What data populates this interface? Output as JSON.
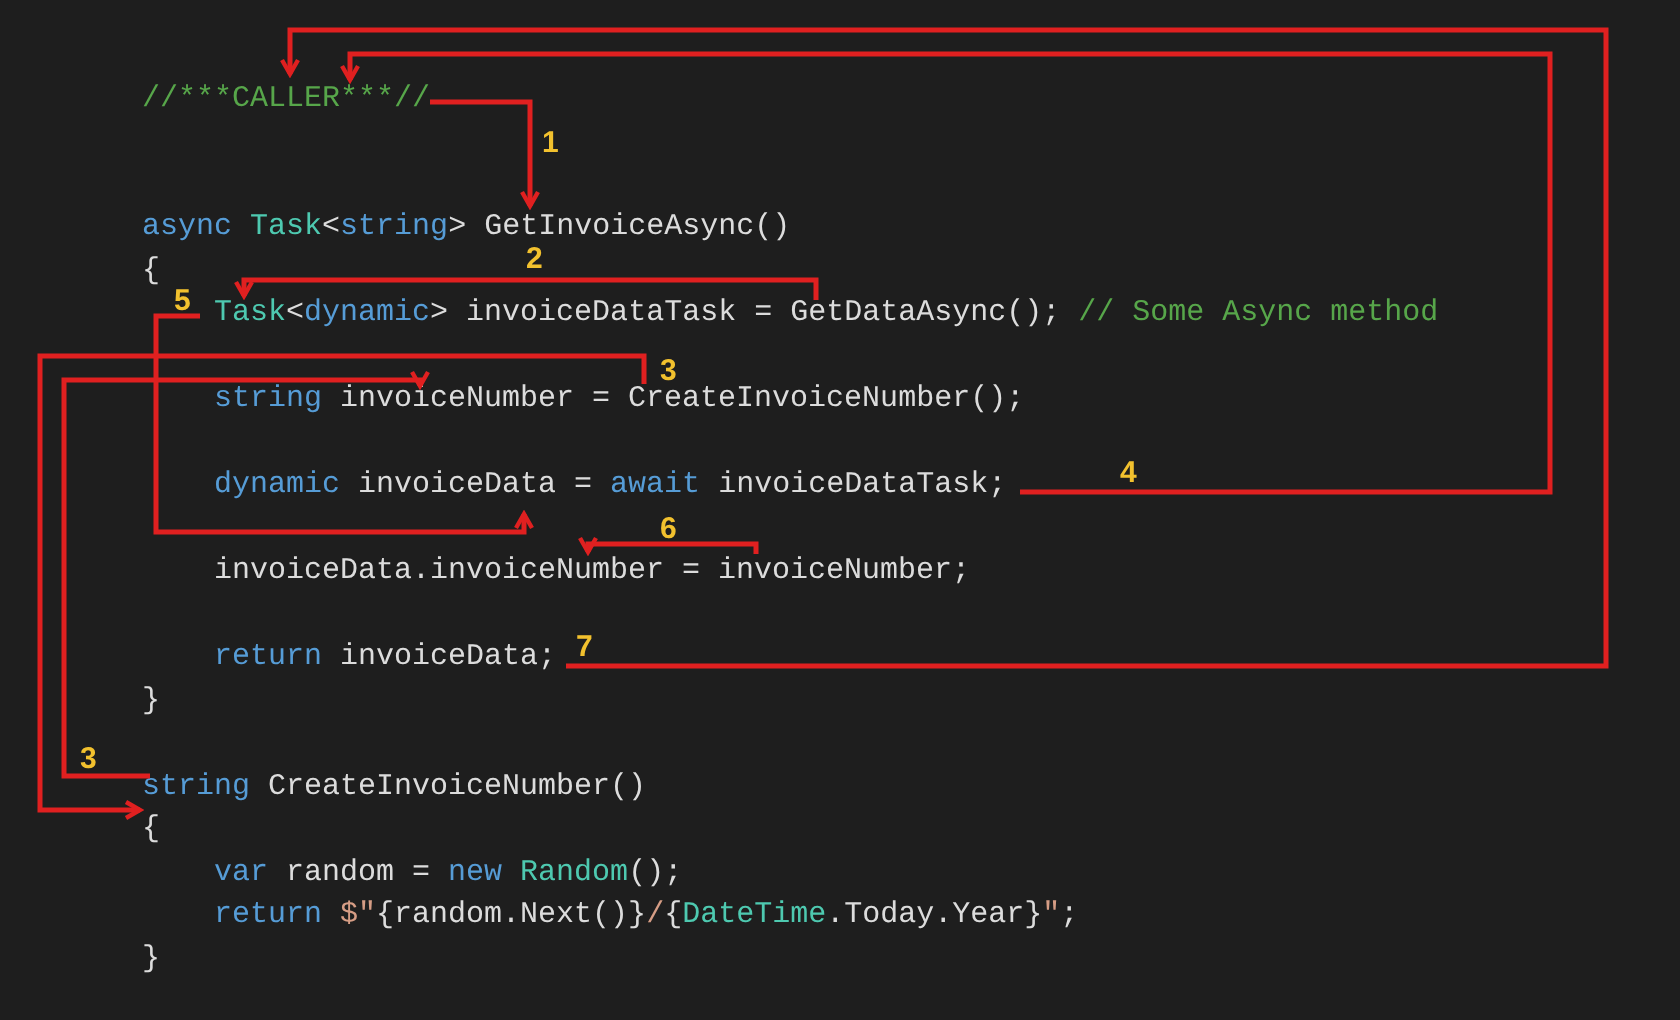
{
  "code_lines": [
    {
      "kind": "code",
      "tokens": [
        {
          "text": "//***CALLER***//",
          "kind": "comment"
        }
      ]
    },
    {
      "kind": "blank"
    },
    {
      "kind": "blank"
    },
    {
      "kind": "code",
      "tokens": [
        {
          "text": "async",
          "kind": "keyword"
        },
        {
          "text": " Task",
          "kind": "type"
        },
        {
          "text": "<",
          "kind": "plain"
        },
        {
          "text": "string",
          "kind": "keyword"
        },
        {
          "text": "> GetInvoiceAsync()",
          "kind": "plain"
        }
      ]
    },
    {
      "kind": "code",
      "tokens": [
        {
          "text": "{",
          "kind": "plain"
        }
      ],
      "children": [
        {
          "kind": "code",
          "tokens": [
            {
              "text": "Task",
              "kind": "type"
            },
            {
              "text": "<",
              "kind": "plain"
            },
            {
              "text": "dynamic",
              "kind": "keyword"
            },
            {
              "text": "> invoiceDataTask = GetDataAsync(); ",
              "kind": "plain"
            },
            {
              "text": "// Some Async method",
              "kind": "comment"
            }
          ]
        },
        {
          "kind": "blank"
        },
        {
          "kind": "code",
          "tokens": [
            {
              "text": "string",
              "kind": "keyword"
            },
            {
              "text": " invoiceNumber = CreateInvoiceNumber();",
              "kind": "plain"
            }
          ]
        },
        {
          "kind": "blank"
        },
        {
          "kind": "code",
          "tokens": [
            {
              "text": "dynamic",
              "kind": "keyword"
            },
            {
              "text": " invoiceData = ",
              "kind": "plain"
            },
            {
              "text": "await",
              "kind": "keyword"
            },
            {
              "text": " invoiceDataTask;",
              "kind": "plain"
            }
          ]
        },
        {
          "kind": "blank"
        },
        {
          "kind": "code",
          "tokens": [
            {
              "text": "invoiceData.invoiceNumber = invoiceNumber;",
              "kind": "plain"
            }
          ]
        },
        {
          "kind": "blank"
        },
        {
          "kind": "code",
          "tokens": [
            {
              "text": "return",
              "kind": "keyword"
            },
            {
              "text": " invoiceData;",
              "kind": "plain"
            }
          ]
        }
      ]
    },
    {
      "kind": "code",
      "tokens": [
        {
          "text": "}",
          "kind": "plain"
        }
      ]
    },
    {
      "kind": "blank"
    },
    {
      "kind": "code",
      "tokens": [
        {
          "text": "string",
          "kind": "keyword"
        },
        {
          "text": " CreateInvoiceNumber()",
          "kind": "plain"
        }
      ]
    },
    {
      "kind": "code",
      "tokens": [
        {
          "text": "{",
          "kind": "plain"
        }
      ],
      "children": [
        {
          "kind": "code",
          "tokens": [
            {
              "text": "var",
              "kind": "keyword"
            },
            {
              "text": " random = ",
              "kind": "plain"
            },
            {
              "text": "new",
              "kind": "keyword"
            },
            {
              "text": " Random",
              "kind": "type"
            },
            {
              "text": "();",
              "kind": "plain"
            }
          ]
        },
        {
          "kind": "code",
          "tokens": [
            {
              "text": "return",
              "kind": "keyword"
            },
            {
              "text": " $\"",
              "kind": "string"
            },
            {
              "text": "{random.Next()}",
              "kind": "plain"
            },
            {
              "text": "/",
              "kind": "string"
            },
            {
              "text": "{",
              "kind": "plain"
            },
            {
              "text": "DateTime",
              "kind": "type"
            },
            {
              "text": ".Today.Year}",
              "kind": "plain"
            },
            {
              "text": "\"",
              "kind": "string"
            },
            {
              "text": ";",
              "kind": "plain"
            }
          ]
        }
      ]
    },
    {
      "kind": "code",
      "tokens": [
        {
          "text": "}",
          "kind": "plain"
        }
      ]
    }
  ],
  "annotations": [
    {
      "label": "1"
    },
    {
      "label": "2"
    },
    {
      "label": "3"
    },
    {
      "label": "3"
    },
    {
      "label": "4"
    },
    {
      "label": "5"
    },
    {
      "label": "6"
    },
    {
      "label": "7"
    }
  ]
}
